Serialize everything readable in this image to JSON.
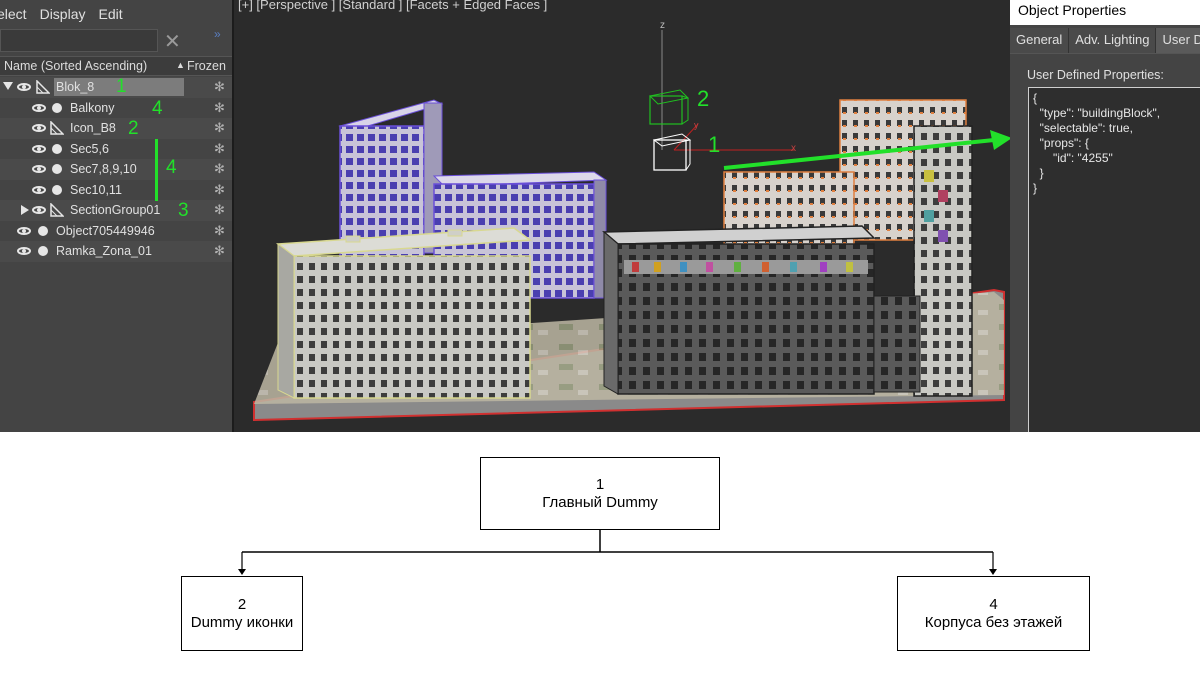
{
  "explorer": {
    "menu": [
      "elect",
      "Display",
      "Edit"
    ],
    "columns": {
      "name": "Name (Sorted Ascending)",
      "frozen": "Frozen"
    },
    "rows": [
      {
        "label": "Blok_8",
        "annotation": "1"
      },
      {
        "label": "Balkony",
        "annotation": "4"
      },
      {
        "label": "Icon_B8",
        "annotation": "2"
      },
      {
        "label": "Sec5,6",
        "annotation": ""
      },
      {
        "label": "Sec7,8,9,10",
        "annotation": "4"
      },
      {
        "label": "Sec10,11",
        "annotation": ""
      },
      {
        "label": "SectionGroup01",
        "annotation": "3"
      },
      {
        "label": "Object705449946",
        "annotation": ""
      },
      {
        "label": "Ramka_Zona_01",
        "annotation": ""
      }
    ],
    "clear_glyph": "✕",
    "collapse_glyph": "»",
    "frozen_glyph": "✻",
    "sort_glyph": "▲"
  },
  "viewport": {
    "label": "[+] [Perspective ] [Standard ] [Facets + Edged Faces ]",
    "axis_labels": {
      "z": "z",
      "x": "x",
      "y": "y"
    },
    "dummy_annotations": [
      "2",
      "1"
    ]
  },
  "properties": {
    "title": "Object Properties",
    "tabs": [
      "General",
      "Adv. Lighting",
      "User D"
    ],
    "udp_label": "User Defined Properties:",
    "udp_text": "{\n  \"type\": \"buildingBlock\",\n  \"selectable\": true,\n  \"props\": {\n      \"id\": \"4255\"\n  }\n}"
  },
  "diagram": {
    "root": {
      "num": "1",
      "label": "Главный Dummy"
    },
    "left": {
      "num": "2",
      "label": "Dummy иконки"
    },
    "right": {
      "num": "4",
      "label": "Корпуса без этажей"
    }
  },
  "colors": {
    "annotation_green": "#22e02a",
    "panel_bg": "#444444",
    "viewport_bg": "#2b2b2b",
    "selection_purple": "#6a4fd8",
    "selection_yellow": "#d8d890",
    "selection_orange": "#e08040",
    "base_outline_red": "#d03030"
  }
}
